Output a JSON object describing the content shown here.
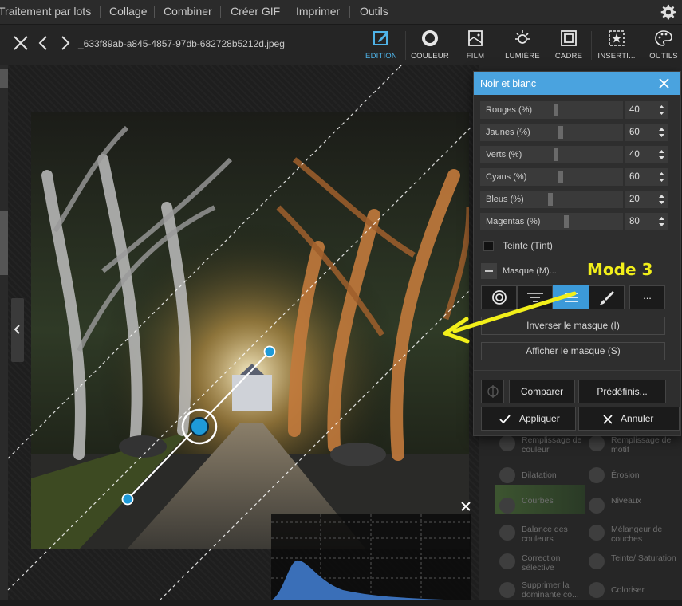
{
  "menu": {
    "items": [
      "Traitement par lots",
      "Collage",
      "Combiner",
      "Créer GIF",
      "Imprimer",
      "Outils"
    ]
  },
  "toolbar": {
    "filename": "_633f89ab-a845-4857-97db-682728b5212d.jpeg",
    "tools": [
      {
        "label": "EDITION",
        "icon": "edit-icon",
        "active": true
      },
      {
        "label": "COULEUR",
        "icon": "color-circle-icon",
        "active": false
      },
      {
        "label": "FILM",
        "icon": "film-icon",
        "active": false
      },
      {
        "label": "LUMIÈRE",
        "icon": "sun-icon",
        "active": false
      },
      {
        "label": "CADRE",
        "icon": "frame-icon",
        "active": false
      },
      {
        "label": "INSERTI...",
        "icon": "insert-star-icon",
        "active": false
      },
      {
        "label": "OUTILS",
        "icon": "palette-icon",
        "active": false
      }
    ]
  },
  "dialog": {
    "title": "Noir et blanc",
    "sliders": [
      {
        "label": "Rouges (%)",
        "value": "40"
      },
      {
        "label": "Jaunes (%)",
        "value": "60"
      },
      {
        "label": "Verts (%)",
        "value": "40"
      },
      {
        "label": "Cyans (%)",
        "value": "60"
      },
      {
        "label": "Bleus (%)",
        "value": "20"
      },
      {
        "label": "Magentas (%)",
        "value": "80"
      }
    ],
    "tint_label": "Teinte (Tint)",
    "mask_label": "Masque (M)...",
    "mask_more_label": "...",
    "invert_mask": "Inverser le masque (I)",
    "show_mask": "Afficher le masque (S)",
    "compare": "Comparer",
    "presets": "Prédéfinis...",
    "apply": "Appliquer",
    "cancel": "Annuler"
  },
  "panel_behind": {
    "items": [
      "Remplissage de couleur",
      "Remplissage de motif",
      "Dilatation",
      "Érosion",
      "Courbes",
      "Niveaux",
      "Balance des couleurs",
      "Mélangeur de couches",
      "Correction sélective",
      "Teinte/ Saturation",
      "Supprimer la dominante co...",
      "Coloriser"
    ]
  },
  "annotation": {
    "text": "Mode 3",
    "color": "#f2ef1a"
  },
  "colors": {
    "accent": "#4aa3df",
    "active_mask_mode": "#3c9ad9"
  }
}
